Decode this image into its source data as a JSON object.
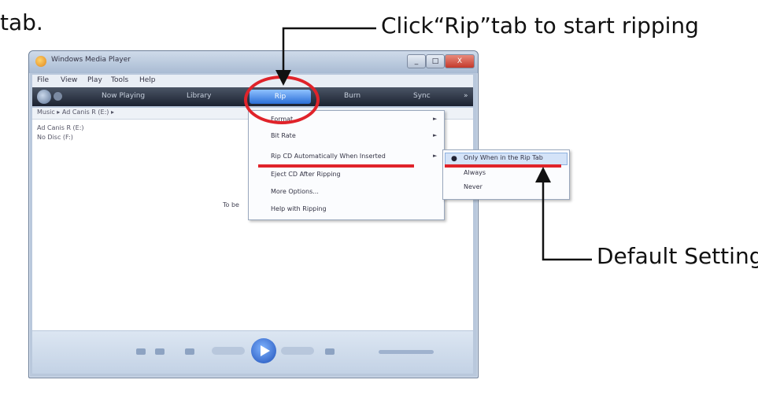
{
  "annotations": {
    "top_left": "tab.",
    "rip_callout": "Click“Rip”tab to start ripping",
    "default_callout": "Default Setting"
  },
  "window": {
    "title": "Windows Media Player",
    "controls": [
      "_",
      "□",
      "X"
    ]
  },
  "menubar": [
    "File",
    "View",
    "Play",
    "Tools",
    "Help"
  ],
  "nav_tabs": [
    "Now Playing",
    "Library",
    "Rip",
    "Burn",
    "Sync"
  ],
  "breadcrumb": "Music ▸ Ad Canis R (E:) ▸",
  "library_items": [
    "Ad Canis R (E:)",
    "No Disc (F:)"
  ],
  "content_hint": "To be",
  "rip_menu": [
    {
      "label": "Format",
      "arrow": true
    },
    {
      "label": "Bit Rate",
      "arrow": true
    },
    {
      "label": "Rip CD Automatically When Inserted",
      "arrow": true
    },
    {
      "label": "Eject CD After Ripping",
      "arrow": false
    },
    {
      "label": "More Options...",
      "arrow": false
    },
    {
      "label": "Help with Ripping",
      "arrow": false
    }
  ],
  "rip_submenu": {
    "items": [
      "Only When in the Rip Tab",
      "Always",
      "Never"
    ],
    "selected_index": 0
  },
  "colors": {
    "callout_red": "#e0232a",
    "arrow_black": "#111111",
    "rip_tab_blue": "#2b6ed6"
  }
}
